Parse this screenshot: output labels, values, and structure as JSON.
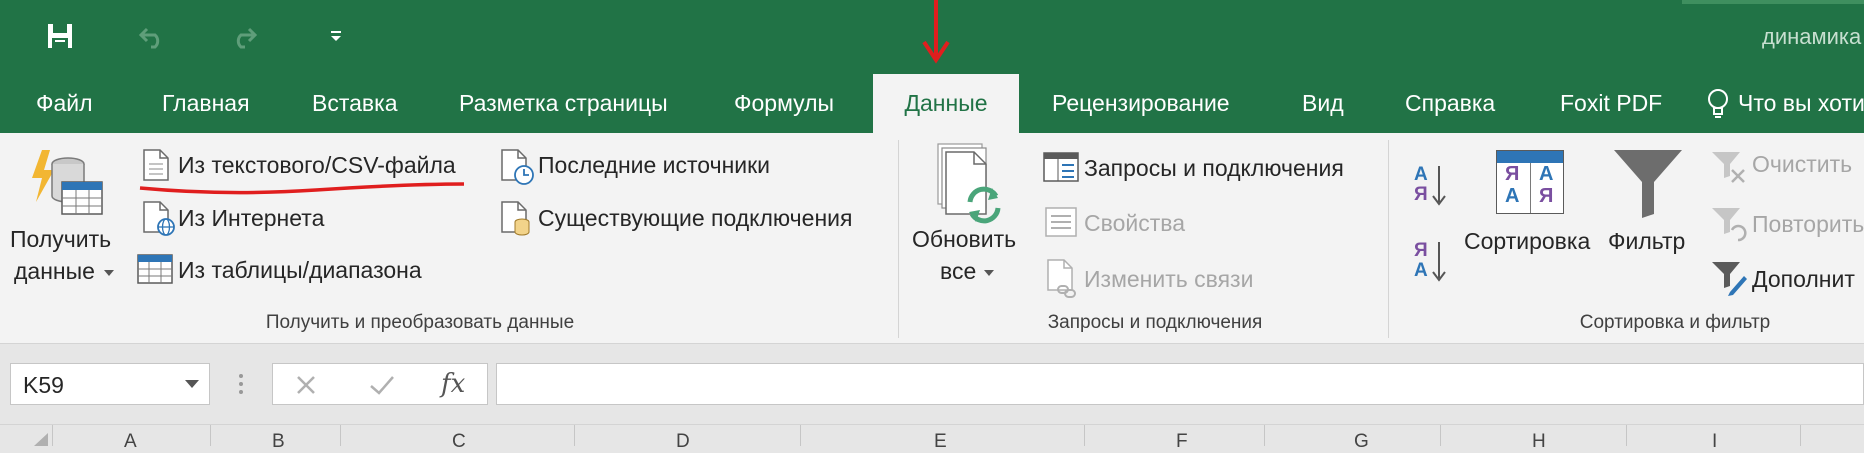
{
  "title_bar": {
    "filename_partial": "динамика",
    "accent_color": "#217346"
  },
  "quick_access": {
    "icons": [
      "save-icon",
      "undo-icon",
      "redo-icon",
      "customize-qat-icon"
    ]
  },
  "tabs": [
    {
      "label": "Файл"
    },
    {
      "label": "Главная"
    },
    {
      "label": "Вставка"
    },
    {
      "label": "Разметка страницы"
    },
    {
      "label": "Формулы"
    },
    {
      "label": "Данные",
      "active": true
    },
    {
      "label": "Рецензирование"
    },
    {
      "label": "Вид"
    },
    {
      "label": "Справка"
    },
    {
      "label": "Foxit PDF"
    },
    {
      "label": "Что вы хоти"
    }
  ],
  "ribbon": {
    "get_transform": {
      "get_data_line1": "Получить",
      "get_data_line2": "данные",
      "from_text_csv": "Из текстового/CSV-файла",
      "from_web": "Из Интернета",
      "from_table": "Из таблицы/диапазона",
      "recent_sources": "Последние источники",
      "existing_connections": "Существующие подключения",
      "group_label": "Получить и преобразовать данные"
    },
    "queries": {
      "refresh_line1": "Обновить",
      "refresh_line2": "все",
      "queries_connections": "Запросы и подключения",
      "properties": "Свойства",
      "edit_links": "Изменить связи",
      "group_label": "Запросы и подключения"
    },
    "sort_filter": {
      "sort": "Сортировка",
      "filter": "Фильтр",
      "clear": "Очистить",
      "reapply": "Повторить",
      "advanced": "Дополнит",
      "group_label": "Сортировка и фильтр",
      "sort_az_letters": [
        "А",
        "Я"
      ],
      "sort_za_letters": [
        "Я",
        "А"
      ]
    }
  },
  "formula_bar": {
    "name_box": "K59",
    "fx_label": "fx",
    "formula": ""
  },
  "columns": [
    "A",
    "B",
    "C",
    "D",
    "E",
    "F",
    "G",
    "H",
    "I"
  ],
  "annotations": {
    "arrow_color": "#e01e1e",
    "underline_color": "#e01e1e"
  }
}
